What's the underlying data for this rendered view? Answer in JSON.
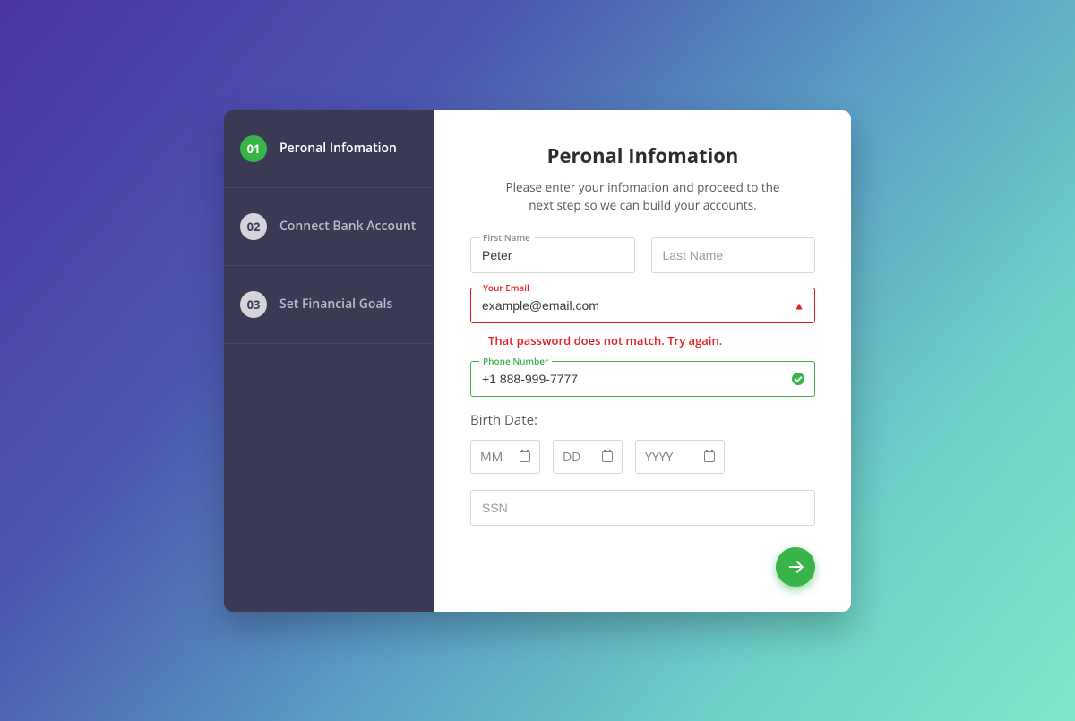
{
  "sidebar": {
    "steps": [
      {
        "num": "01",
        "label": "Peronal Infomation"
      },
      {
        "num": "02",
        "label": "Connect Bank Account"
      },
      {
        "num": "03",
        "label": "Set Financial Goals"
      }
    ]
  },
  "main": {
    "title": "Peronal Infomation",
    "subtitle": "Please enter your infomation and proceed to the next step so we can build your accounts.",
    "first_name_label": "First Name",
    "first_name_value": "Peter",
    "last_name_placeholder": "Last Name",
    "email_label": "Your Email",
    "email_value": "example@email.com",
    "error_message": "That password does not match. Try again.",
    "phone_label": "Phone Number",
    "phone_value": "+1 888-999-7777",
    "birth_label": "Birth Date:",
    "mm": "MM",
    "dd": "DD",
    "yyyy": "YYYY",
    "ssn_placeholder": "SSN"
  }
}
